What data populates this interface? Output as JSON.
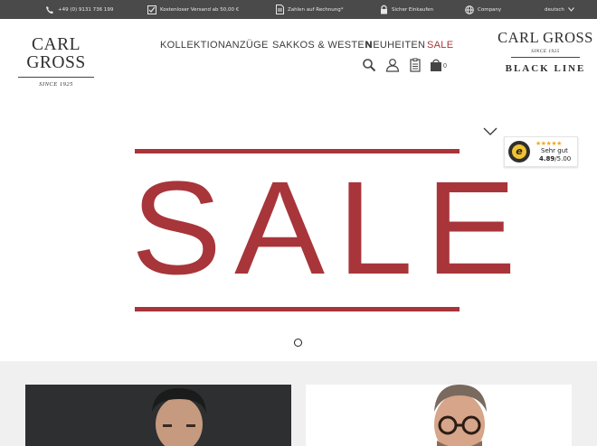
{
  "topbar": {
    "phone": "+49 (0) 9131 736 199",
    "shipping": "Kostenloser Versand ab 50,00 €",
    "invoice": "Zahlen auf Rechnung*",
    "secure": "Sicher Einkaufen",
    "company": "Company",
    "language": "deutsch"
  },
  "brand": {
    "name": "CARL GROSS",
    "since": "SINCE 1925"
  },
  "nav": [
    "KOLLEKTION",
    "ANZÜGE",
    "SAKKOS & WESTEN",
    "NEUHEITEN",
    "SALE"
  ],
  "header_icons": [
    "search-icon",
    "account-icon",
    "wishlist-icon",
    "cart-icon"
  ],
  "cart_count": "0",
  "black_line": {
    "name": "CARL GROSS",
    "since": "SINCE 1925",
    "line": "BLACK LINE"
  },
  "hero": {
    "text": "SALE",
    "color": "#a8353a"
  },
  "trusted_shops": {
    "stars": "★★★★★",
    "rating_label": "Sehr gut",
    "score": "4.89",
    "max": "/5.00"
  },
  "colors": {
    "topbar_bg": "#4a4a4a",
    "accent": "#a8353a",
    "lower_bg": "#f0f0f0"
  }
}
